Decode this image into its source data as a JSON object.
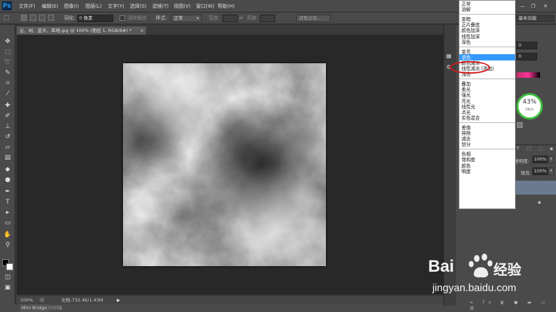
{
  "app": {
    "logo": "Ps"
  },
  "menu": [
    "文件(F)",
    "编辑(E)",
    "图像(I)",
    "图层(L)",
    "文字(Y)",
    "选择(S)",
    "滤镜(T)",
    "视图(V)",
    "窗口(W)",
    "帮助(H)"
  ],
  "options": {
    "feather_label": "羽化:",
    "feather_value": "0 像素",
    "antialias_label": "消除锯齿",
    "style_label": "样式:",
    "style_value": "正常",
    "width_label": "宽度:",
    "height_label": "高度:",
    "refine_edge_button": "调整边缘...",
    "workspace": "基本功能"
  },
  "document": {
    "tab_title": "云、树、蓝天、草地.jpg @ 100% (图层 1, RGB/8#) *",
    "zoom": "100%",
    "doc_info": "文档:732.4K/1.43M"
  },
  "bottom_tabs": [
    "Mini Bridge",
    "时间轴"
  ],
  "blend_modes": {
    "groups": [
      [
        "正常",
        "溶解"
      ],
      [
        "变暗",
        "正片叠底",
        "颜色加深",
        "线性加深",
        "深色"
      ],
      [
        "变亮",
        "滤色",
        "颜色减淡",
        "线性减淡 (添加)",
        "浅色"
      ],
      [
        "叠加",
        "柔光",
        "强光",
        "亮光",
        "线性光",
        "点光",
        "实色混合"
      ],
      [
        "差值",
        "排除",
        "减去",
        "划分"
      ],
      [
        "色相",
        "饱和度",
        "颜色",
        "明度"
      ]
    ],
    "selected": "滤色"
  },
  "right_panel": {
    "field1": "0",
    "field2": "0",
    "speed_percent": "43%",
    "speed_rate": "0K/s",
    "opacity_label": "透明度:",
    "opacity_value": "100%",
    "fill_label": "填充:",
    "fill_value": "100%"
  },
  "watermark": {
    "brand": "Bai",
    "brand2": "经验",
    "url": "jingyan.baidu.com"
  },
  "colors": {
    "accent": "#3399ff",
    "highlight_circle": "#d41a1a",
    "progress": "#3fbf3f"
  }
}
